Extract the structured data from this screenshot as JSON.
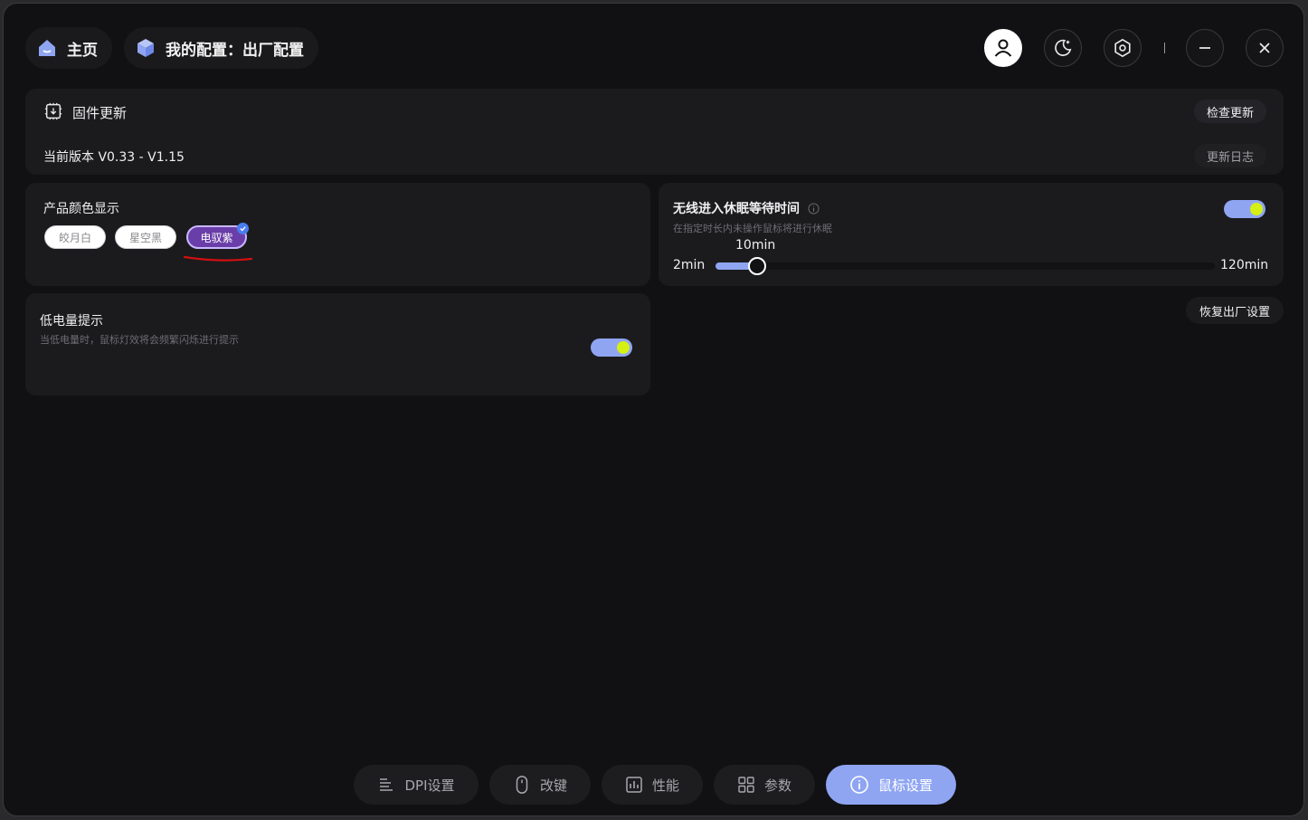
{
  "header": {
    "home_label": "主页",
    "config_label": "我的配置：出厂配置",
    "icons": [
      "home-icon",
      "cube-icon",
      "user-icon",
      "moon-icon",
      "settings-icon",
      "minimize-icon",
      "close-icon"
    ]
  },
  "firmware": {
    "title": "固件更新",
    "version": "当前版本 V0.33 - V1.15",
    "check_update": "检查更新",
    "changelog": "更新日志"
  },
  "color_display": {
    "title": "产品颜色显示",
    "options": [
      "皎月白",
      "星空黑",
      "电驭紫"
    ],
    "selected": "电驭紫"
  },
  "sleep": {
    "title": "无线进入休眠等待时间",
    "subtitle": "在指定时长内未操作鼠标将进行休眠",
    "enabled": true,
    "min_label": "2min",
    "max_label": "120min",
    "value_label": "10min",
    "min": 2,
    "max": 120,
    "value": 10
  },
  "low_battery": {
    "title": "低电量提示",
    "subtitle": "当低电量时，鼠标灯效将会频繁闪烁进行提示",
    "enabled": true
  },
  "reset_label": "恢复出厂设置",
  "bottom_nav": [
    {
      "label": "DPI设置",
      "icon": "dpi-icon"
    },
    {
      "label": "改键",
      "icon": "mouse-icon"
    },
    {
      "label": "性能",
      "icon": "performance-icon"
    },
    {
      "label": "参数",
      "icon": "grid-icon"
    },
    {
      "label": "鼠标设置",
      "icon": "info-icon",
      "active": true
    }
  ],
  "colors": {
    "accent": "#8fa5f2",
    "toggle_knob": "#d4f014",
    "selected_chip": "#6a3ea8",
    "background": "#111113",
    "card": "#1b1b1e"
  }
}
